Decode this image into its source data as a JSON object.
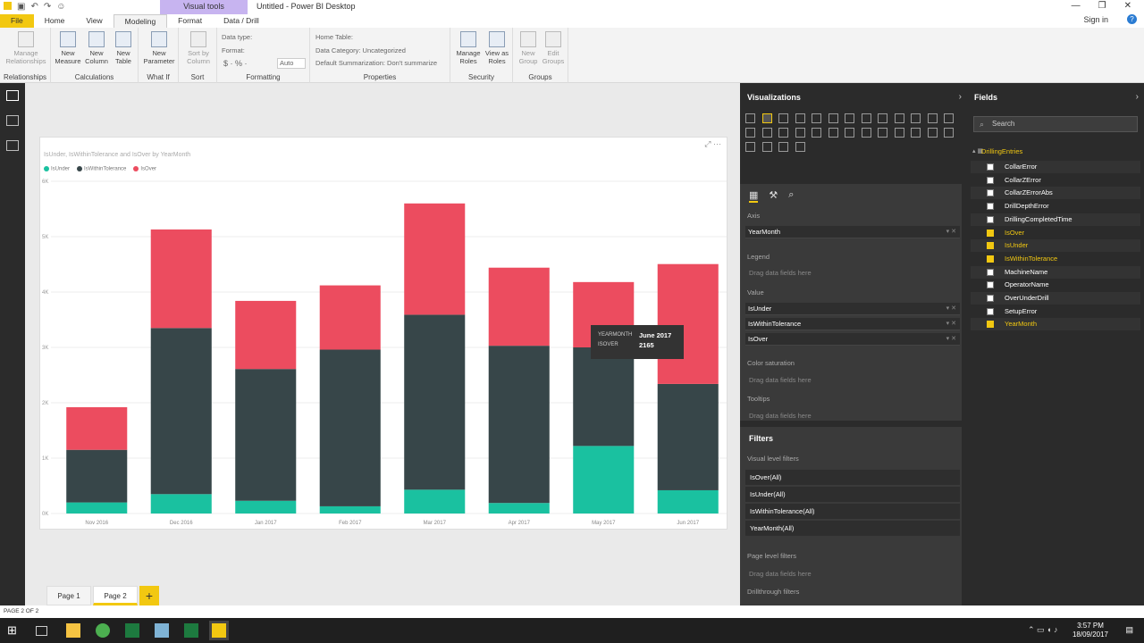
{
  "titlebar": {
    "context_tab": "Visual tools",
    "app_title": "Untitled - Power BI Desktop"
  },
  "tabs": [
    "File",
    "Home",
    "View",
    "Modeling",
    "Format",
    "Data / Drill"
  ],
  "signin": "Sign in",
  "ribbon": {
    "relationships": {
      "label": "Relationships",
      "buttons": [
        "Manage Relationships"
      ]
    },
    "calculations": {
      "label": "Calculations",
      "buttons": [
        "New Measure",
        "New Column",
        "New Table"
      ]
    },
    "whatif": {
      "label": "What If",
      "buttons": [
        "New Parameter"
      ]
    },
    "sort": {
      "label": "Sort",
      "buttons": [
        "Sort by Column"
      ]
    },
    "formatting": {
      "label": "Formatting",
      "datatype": "Data type:",
      "format": "Format:",
      "auto": "Auto"
    },
    "properties": {
      "label": "Properties",
      "hometable": "Home Table:",
      "category": "Data Category: Uncategorized",
      "summarization": "Default Summarization: Don't summarize"
    },
    "security": {
      "label": "Security",
      "buttons": [
        "Manage Roles",
        "View as Roles"
      ]
    },
    "groups": {
      "label": "Groups",
      "buttons": [
        "New Group",
        "Edit Groups"
      ]
    }
  },
  "visual": {
    "title": "IsUnder, IsWithinTolerance and IsOver by YearMonth",
    "legend": [
      {
        "name": "IsUnder",
        "color": "#1ac1a0"
      },
      {
        "name": "IsWithinTolerance",
        "color": "#374649"
      },
      {
        "name": "IsOver",
        "color": "#ec4c5f"
      }
    ]
  },
  "chart_data": {
    "type": "bar",
    "stacked": true,
    "title": "IsUnder, IsWithinTolerance and IsOver by YearMonth",
    "categories": [
      "Nov 2016",
      "Dec 2016",
      "Jan 2017",
      "Feb 2017",
      "Mar 2017",
      "Apr 2017",
      "May 2017",
      "Jun 2017"
    ],
    "series": [
      {
        "name": "IsUnder",
        "color": "#1ac1a0",
        "values": [
          200,
          350,
          230,
          130,
          430,
          190,
          1220,
          420
        ]
      },
      {
        "name": "IsWithinTolerance",
        "color": "#374649",
        "values": [
          950,
          3000,
          2380,
          2830,
          3160,
          2840,
          1780,
          1920
        ]
      },
      {
        "name": "IsOver",
        "color": "#ec4c5f",
        "values": [
          770,
          1780,
          1230,
          1160,
          2010,
          1410,
          1180,
          2165
        ]
      }
    ],
    "ylim": [
      0,
      6000
    ],
    "yticks": [
      "0K",
      "1K",
      "2K",
      "3K",
      "4K",
      "5K",
      "6K"
    ],
    "grid": true,
    "legend": "top-left"
  },
  "tooltip": {
    "k1": "YEARMONTH",
    "v1": "June 2017",
    "k2": "ISOVER",
    "v2": "2165"
  },
  "pages": [
    "Page 1",
    "Page 2"
  ],
  "status": "PAGE 2 OF 2",
  "visualizations": {
    "header": "Visualizations",
    "axis": "Axis",
    "axis_field": "YearMonth",
    "legend": "Legend",
    "drag": "Drag data fields here",
    "value": "Value",
    "values": [
      "IsUnder",
      "IsWithinTolerance",
      "IsOver"
    ],
    "color_saturation": "Color saturation",
    "tooltips": "Tooltips"
  },
  "filters": {
    "header": "Filters",
    "visual_level": "Visual level filters",
    "items": [
      "IsOver(All)",
      "IsUnder(All)",
      "IsWithinTolerance(All)",
      "YearMonth(All)"
    ],
    "page_level": "Page level filters",
    "drag": "Drag data fields here",
    "drillthrough": "Drillthrough filters"
  },
  "fields": {
    "header": "Fields",
    "search": "Search",
    "table": "DrillingEntries",
    "items": [
      {
        "name": "CollarError",
        "checked": false
      },
      {
        "name": "CollarZError",
        "checked": false
      },
      {
        "name": "CollarZErrorAbs",
        "checked": false
      },
      {
        "name": "DrillDepthError",
        "checked": false
      },
      {
        "name": "DrillingCompletedTime",
        "checked": false
      },
      {
        "name": "IsOver",
        "checked": true
      },
      {
        "name": "IsUnder",
        "checked": true
      },
      {
        "name": "IsWithinTolerance",
        "checked": true
      },
      {
        "name": "MachineName",
        "checked": false
      },
      {
        "name": "OperatorName",
        "checked": false
      },
      {
        "name": "OverUnderDrill",
        "checked": false
      },
      {
        "name": "SetupError",
        "checked": false
      },
      {
        "name": "YearMonth",
        "checked": true
      }
    ]
  },
  "clock": {
    "time": "3:57 PM",
    "date": "18/09/2017"
  }
}
